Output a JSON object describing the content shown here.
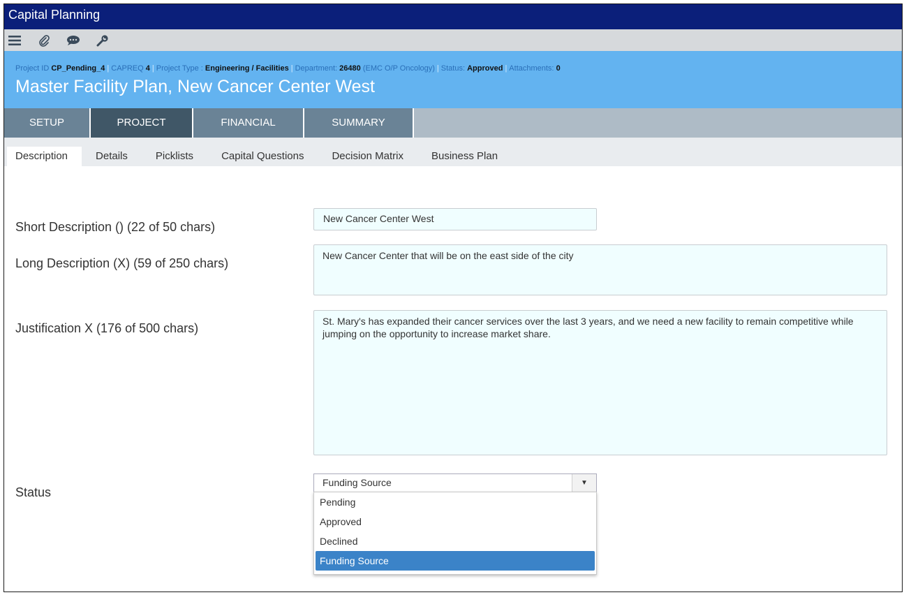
{
  "app": {
    "title": "Capital Planning"
  },
  "toolbar": {
    "icons": [
      "menu-icon",
      "paperclip-icon",
      "comment-icon",
      "wrench-icon"
    ]
  },
  "project": {
    "meta": {
      "id_label": "Project ID",
      "id_value": "CP_Pending_4",
      "capreq_label": "CAPREQ",
      "capreq_value": "4",
      "type_label": "Project Type :",
      "type_value": "Engineering / Facilities",
      "dept_label": "Department:",
      "dept_value": "26480",
      "dept_name": "(EMC O/P Oncology)",
      "status_label": "Status:",
      "status_value": "Approved",
      "attach_label": "Attachments:",
      "attach_value": "0"
    },
    "title": "Master Facility Plan, New Cancer Center West"
  },
  "main_tabs": [
    {
      "label": "SETUP"
    },
    {
      "label": "PROJECT"
    },
    {
      "label": "FINANCIAL"
    },
    {
      "label": "SUMMARY"
    }
  ],
  "sub_tabs": [
    {
      "label": "Description"
    },
    {
      "label": "Details"
    },
    {
      "label": "Picklists"
    },
    {
      "label": "Capital Questions"
    },
    {
      "label": "Decision Matrix"
    },
    {
      "label": "Business Plan"
    }
  ],
  "form": {
    "short_desc": {
      "label": "Short Description () (22 of 50 chars)",
      "value": "New Cancer Center West"
    },
    "long_desc": {
      "label": "Long Description (X) (59 of 250 chars)",
      "value": "New Cancer Center that will be on the east side of the city"
    },
    "justification": {
      "label": "Justification X (176 of 500 chars)",
      "value": "St. Mary's has expanded their cancer services over the last 3 years, and we need a new facility to remain competitive while jumping on the opportunity to increase market share."
    },
    "status": {
      "label": "Status",
      "selected": "Funding Source",
      "options": [
        "Pending",
        "Approved",
        "Declined",
        "Funding Source"
      ]
    }
  },
  "colors": {
    "title_bar": "#0b1f7a",
    "header": "#63b3f0",
    "tab_active": "#405767",
    "tab": "#6a8396",
    "selected_option": "#3b83c8"
  }
}
